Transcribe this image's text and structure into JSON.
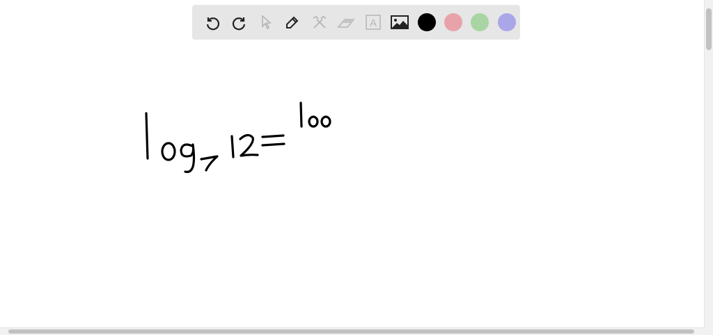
{
  "toolbar": {
    "tools": [
      {
        "icon": "undo-icon",
        "state": "enabled"
      },
      {
        "icon": "redo-icon",
        "state": "enabled"
      },
      {
        "icon": "select-pointer-icon",
        "state": "disabled"
      },
      {
        "icon": "pen-icon",
        "state": "enabled"
      },
      {
        "icon": "tools-icon",
        "state": "disabled"
      },
      {
        "icon": "eraser-icon",
        "state": "disabled"
      },
      {
        "icon": "text-box-icon",
        "state": "disabled"
      },
      {
        "icon": "image-icon",
        "state": "enabled"
      }
    ],
    "colors": [
      "#000000",
      "#e8a3aa",
      "#a9d4a4",
      "#aaa6e8"
    ],
    "text_tool_glyph": "A"
  },
  "canvas": {
    "handwriting": "log_7 12 = loo"
  }
}
